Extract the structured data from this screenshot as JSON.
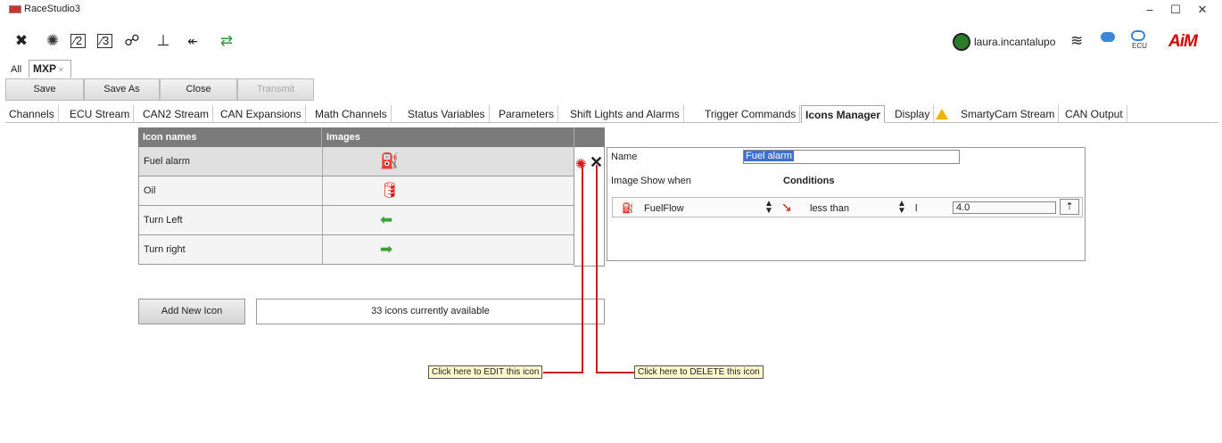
{
  "window": {
    "title": "RaceStudio3",
    "minimize": "–",
    "maximize": "☐",
    "close": "✕"
  },
  "toolbar": {
    "icons": [
      "wrench-icon",
      "gear-icon",
      "channel-config-icon",
      "math-channel-icon",
      "track-icon",
      "chart-icon",
      "add-device-icon",
      "transfer-icon"
    ],
    "user": "laura.incantalupo",
    "brand": "AiM"
  },
  "device_tabs": {
    "all": "All",
    "current": "MXP",
    "close_symbol": "✕"
  },
  "actions": {
    "save": "Save",
    "save_as": "Save As",
    "close": "Close",
    "transmit": "Transmit"
  },
  "tabs": [
    "Channels",
    "ECU Stream",
    "CAN2 Stream",
    "CAN Expansions",
    "Math Channels",
    "Status Variables",
    "Parameters",
    "Shift Lights and Alarms",
    "Trigger Commands",
    "Icons Manager",
    "Display",
    "SmartyCam Stream",
    "CAN Output"
  ],
  "grid": {
    "col_names": "Icon names",
    "col_images": "Images",
    "rows": [
      {
        "name": "Fuel alarm",
        "icon": "fuel-icon",
        "glyph": "⛽",
        "color": "#f0a800"
      },
      {
        "name": "Oil",
        "icon": "oil-can-icon",
        "glyph": "🛢",
        "color": "#d11"
      },
      {
        "name": "Turn Left",
        "icon": "arrow-left-icon",
        "glyph": "⬅",
        "color": "#3aa335"
      },
      {
        "name": "Turn right",
        "icon": "arrow-right-icon",
        "glyph": "➡",
        "color": "#3aa335"
      }
    ]
  },
  "add_button": "Add New Icon",
  "available_text": "33 icons currently available",
  "editor": {
    "name_label": "Name",
    "name_value": "Fuel alarm",
    "image_label": "Image",
    "show_when_label": "Show when",
    "conditions_label": "Conditions",
    "channel": "FuelFlow",
    "operator": "less than",
    "unit": "l",
    "value": "4.0"
  },
  "callouts": {
    "edit": "Click here to  EDIT  this icon",
    "delete": "Click here to  DELETE  this icon"
  }
}
